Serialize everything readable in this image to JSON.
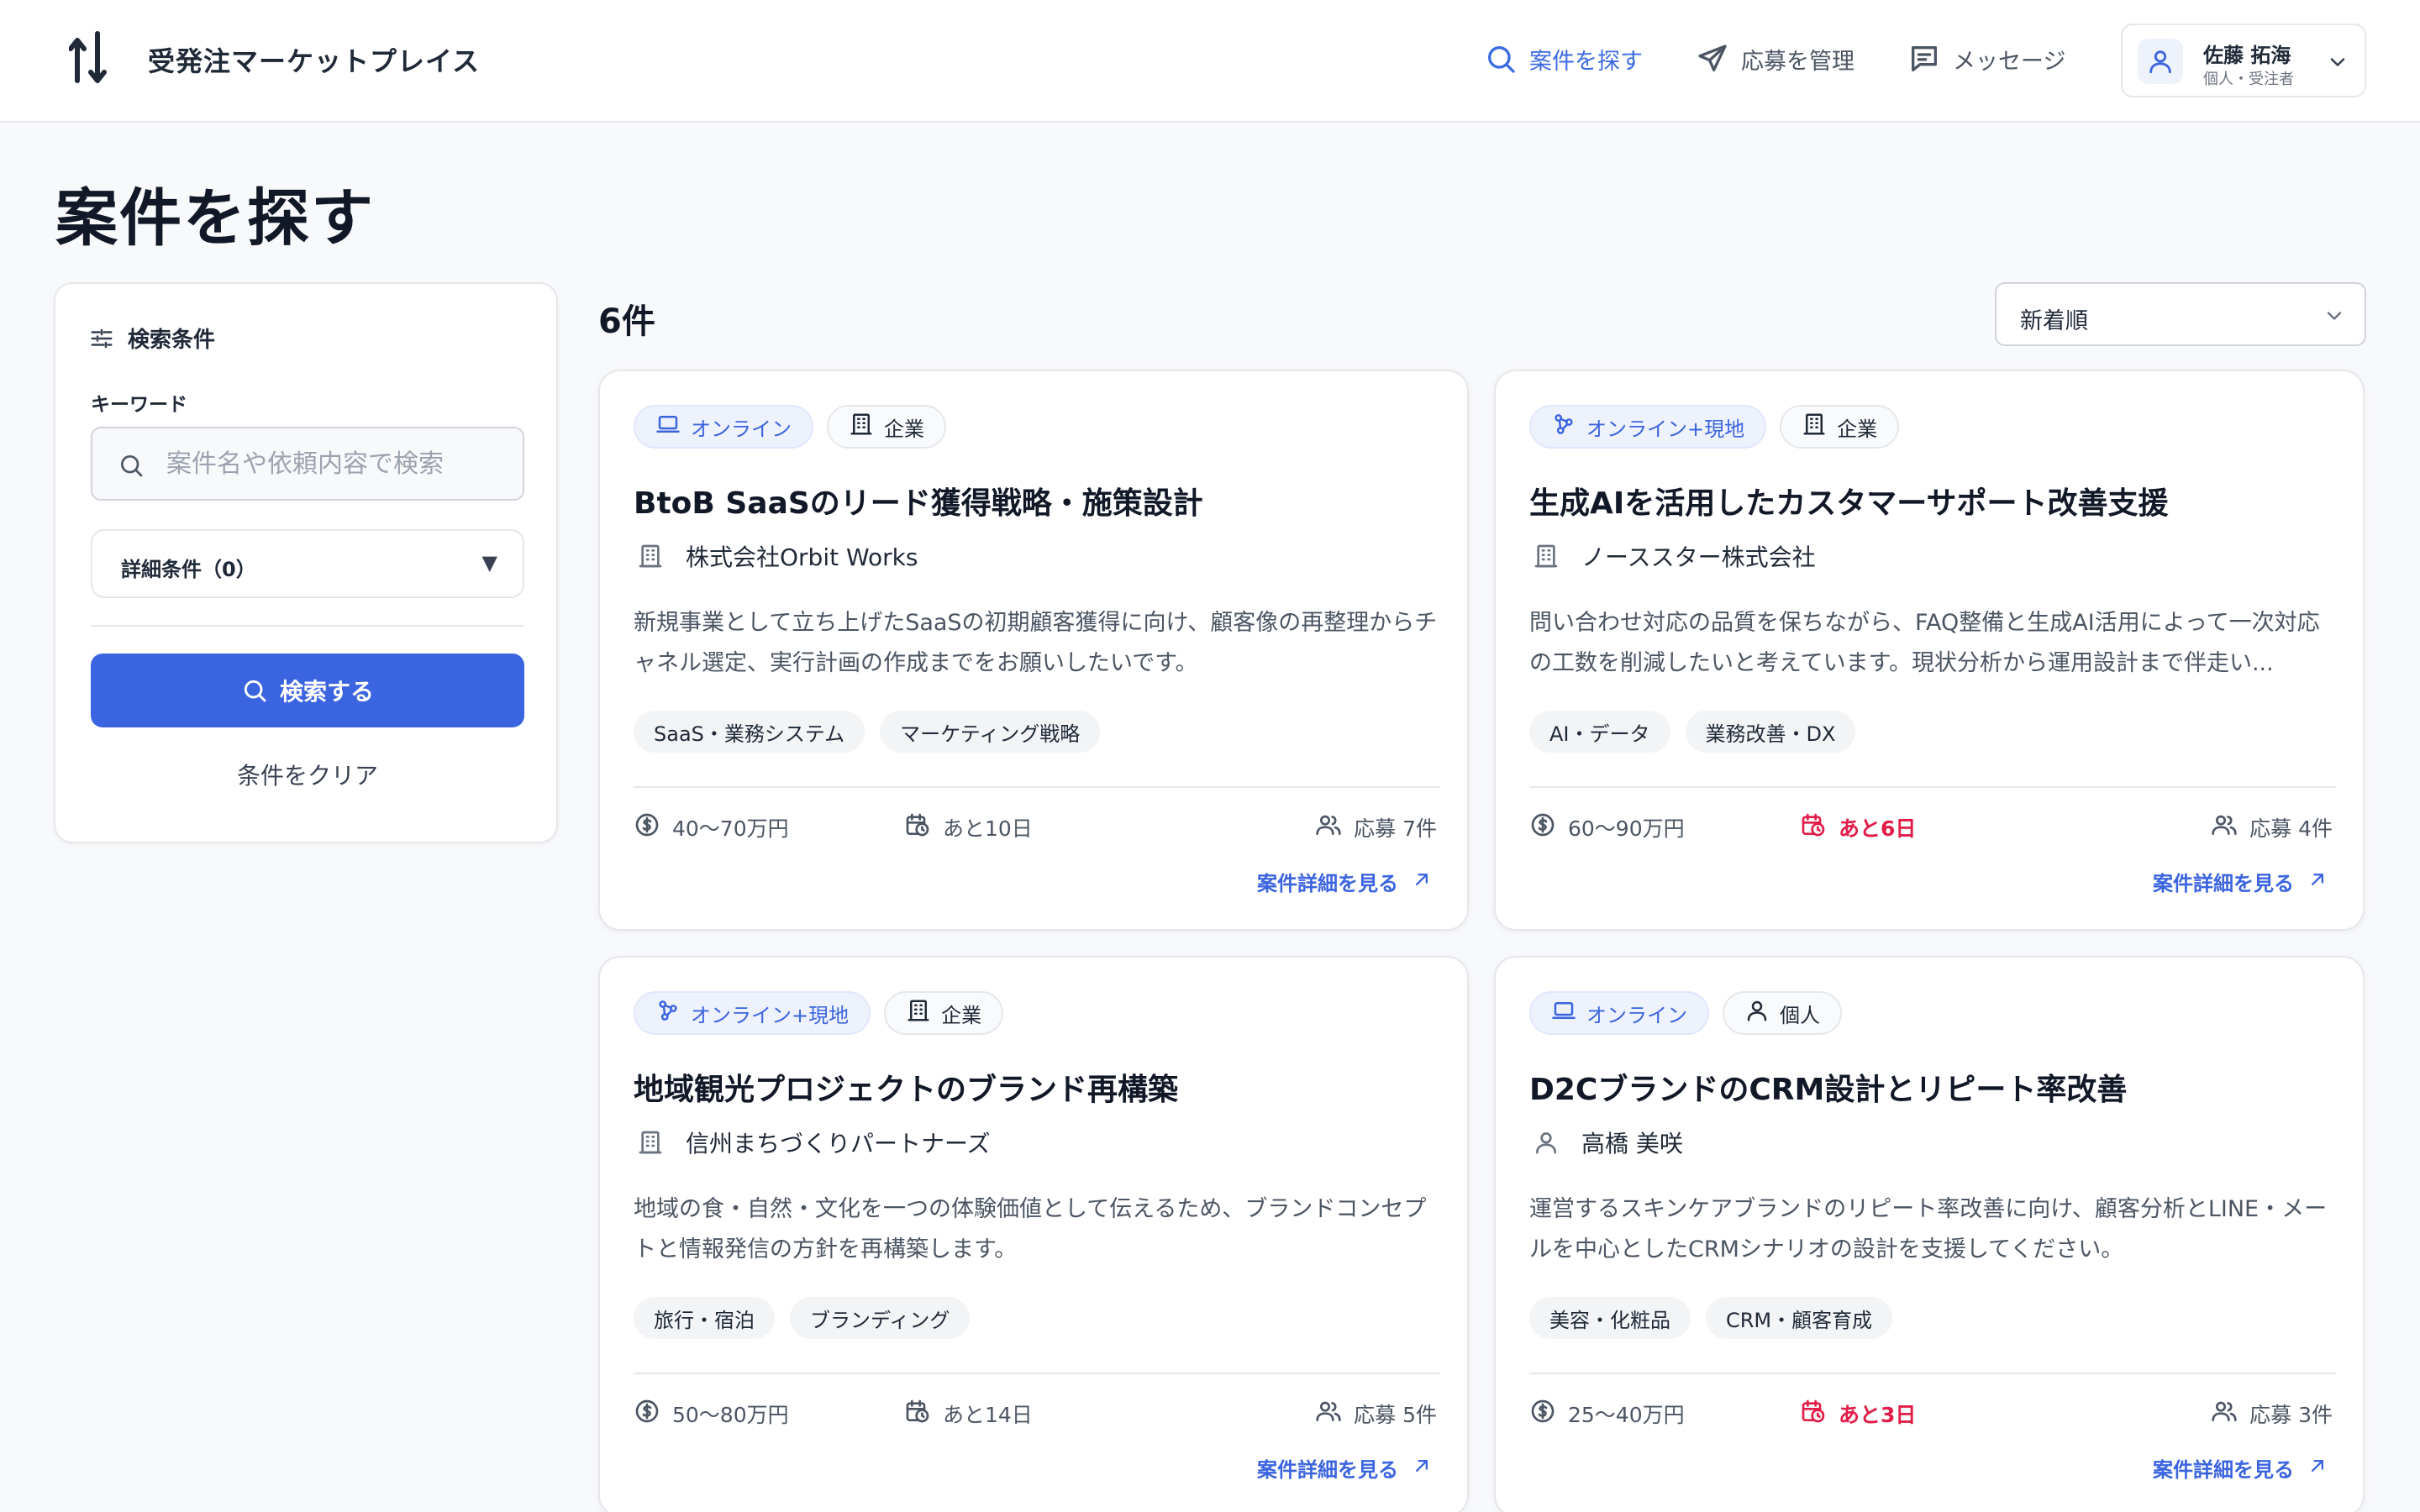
{
  "header": {
    "brand": "受発注マーケットプレイス",
    "nav": [
      {
        "label": "案件を探す",
        "icon": "search-icon",
        "active": true
      },
      {
        "label": "応募を管理",
        "icon": "send-icon",
        "active": false
      },
      {
        "label": "メッセージ",
        "icon": "message-icon",
        "active": false
      }
    ],
    "user": {
      "name": "佐藤 拓海",
      "role": "個人・受注者"
    }
  },
  "page_title": "案件を探す",
  "sidebar": {
    "heading": "検索条件",
    "keyword_label": "キーワード",
    "keyword_placeholder": "案件名や依頼内容で検索",
    "keyword_value": "",
    "detail_label": "詳細条件（0）",
    "detail_arrow": "▼",
    "search_button": "検索する",
    "clear_button": "条件をクリア"
  },
  "results": {
    "count": "6件",
    "sort": "新着順",
    "cards": [
      {
        "mode": "オンライン",
        "mode_icon": "laptop-icon",
        "client_type": "企業",
        "client_type_icon": "building-icon",
        "title": "BtoB SaaSのリード獲得戦略・施策設計",
        "client": "株式会社Orbit Works",
        "client_icon": "building-icon",
        "description": "新規事業として立ち上げたSaaSの初期顧客獲得に向け、顧客像の再整理からチャネル選定、実行計画の作成までをお願いしたいです。",
        "tags": [
          "SaaS・業務システム",
          "マーケティング戦略"
        ],
        "budget": "40〜70万円",
        "deadline": "あと10日",
        "urgent": false,
        "applicants": "応募 7件",
        "link": "案件詳細を見る"
      },
      {
        "mode": "オンライン+現地",
        "mode_icon": "network-icon",
        "client_type": "企業",
        "client_type_icon": "building-icon",
        "title": "生成AIを活用したカスタマーサポート改善支援",
        "client": "ノーススター株式会社",
        "client_icon": "building-icon",
        "description": "問い合わせ対応の品質を保ちながら、FAQ整備と生成AI活用によって一次対応の工数を削減したいと考えています。現状分析から運用設計まで伴走い...",
        "tags": [
          "AI・データ",
          "業務改善・DX"
        ],
        "budget": "60〜90万円",
        "deadline": "あと6日",
        "urgent": true,
        "applicants": "応募 4件",
        "link": "案件詳細を見る"
      },
      {
        "mode": "オンライン+現地",
        "mode_icon": "network-icon",
        "client_type": "企業",
        "client_type_icon": "building-icon",
        "title": "地域観光プロジェクトのブランド再構築",
        "client": "信州まちづくりパートナーズ",
        "client_icon": "building-icon",
        "description": "地域の食・自然・文化を一つの体験価値として伝えるため、ブランドコンセプトと情報発信の方針を再構築します。",
        "tags": [
          "旅行・宿泊",
          "ブランディング"
        ],
        "budget": "50〜80万円",
        "deadline": "あと14日",
        "urgent": false,
        "applicants": "応募 5件",
        "link": "案件詳細を見る"
      },
      {
        "mode": "オンライン",
        "mode_icon": "laptop-icon",
        "client_type": "個人",
        "client_type_icon": "person-icon",
        "title": "D2CブランドのCRM設計とリピート率改善",
        "client": "高橋 美咲",
        "client_icon": "person-icon",
        "description": "運営するスキンケアブランドのリピート率改善に向け、顧客分析とLINE・メールを中心としたCRMシナリオの設計を支援してください。",
        "tags": [
          "美容・化粧品",
          "CRM・顧客育成"
        ],
        "budget": "25〜40万円",
        "deadline": "あと3日",
        "urgent": true,
        "applicants": "応募 3件",
        "link": "案件詳細を見る"
      }
    ]
  },
  "colors": {
    "accent": "#3b64e0",
    "urgent": "#e11d48",
    "text": "#1f2937",
    "muted": "#4b5563"
  }
}
